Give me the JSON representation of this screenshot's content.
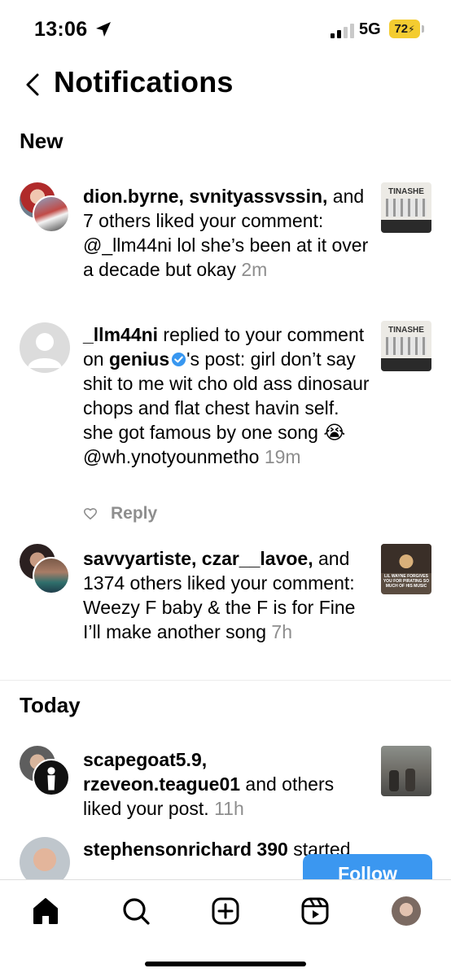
{
  "status_bar": {
    "time": "13:06",
    "network": "5G",
    "battery": "72",
    "battery_color": "#f4cc30"
  },
  "header": {
    "title": "Notifications",
    "back_icon": "chevron-left-icon"
  },
  "sections": {
    "new": "New",
    "today": "Today"
  },
  "notifications": [
    {
      "users": "dion.byrne, svnityassvssin,",
      "text": " and 7 others liked your comment: @_llm44ni lol she’s been at it over a decade but okay ",
      "time": "2m",
      "thumb_label": "TINASHE"
    },
    {
      "users": "_llm44ni",
      "text_a": " replied to your comment on ",
      "account": "genius",
      "text_b": "'s post: girl don’t say shit to me wit cho old ass dinosaur chops and flat chest havin self. she got famous by one song 😭 @wh.ynotyounmetho ",
      "time": "19m",
      "reply_label": "Reply",
      "thumb_label": "TINASHE"
    },
    {
      "users": "savvyartiste, czar__lavoe,",
      "text": " and 1374 others liked your comment: Weezy F baby & the F is for Fine I’ll make another song ",
      "time": "7h",
      "thumb_label": "LIL WAYNE FORGIVES YOU FOR PIRATING SO MUCH OF HIS MUSIC"
    },
    {
      "users_a": "scapegoat5.9,",
      "users_b": "rzeveon.teague01",
      "text": " and others liked your post. ",
      "time": "11h"
    },
    {
      "users": "stephensonrichard 390",
      "text": " started",
      "follow_label": "Follow"
    }
  ],
  "colors": {
    "follow_button": "#3b97f0",
    "timestamp": "#8e8e8e",
    "verified_badge": "#3897f0"
  },
  "bottom_nav": [
    "home-icon",
    "search-icon",
    "create-icon",
    "reels-icon",
    "profile-avatar"
  ]
}
